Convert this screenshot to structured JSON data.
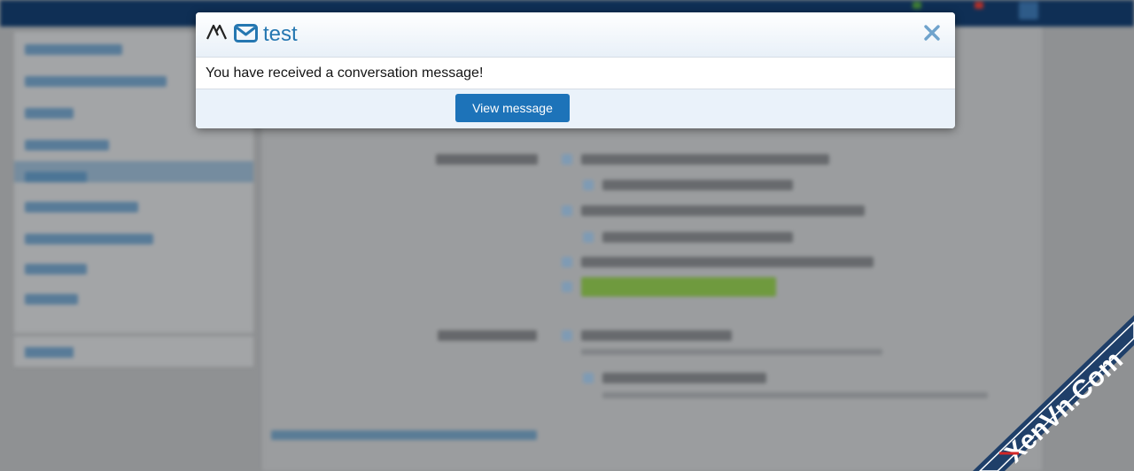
{
  "notification": {
    "title": "test",
    "message": "You have received a conversation message!",
    "button_label": "View message",
    "logo_icon": "xenforo-logo-icon",
    "title_icon": "envelope-icon",
    "close_icon": "close-icon"
  },
  "watermark": {
    "text": "XenVn.Com"
  },
  "colors": {
    "accent": "#2577b1",
    "button": "#1d73b9",
    "footer_bg": "#eaf2fa",
    "overlay": "#8f9193"
  }
}
